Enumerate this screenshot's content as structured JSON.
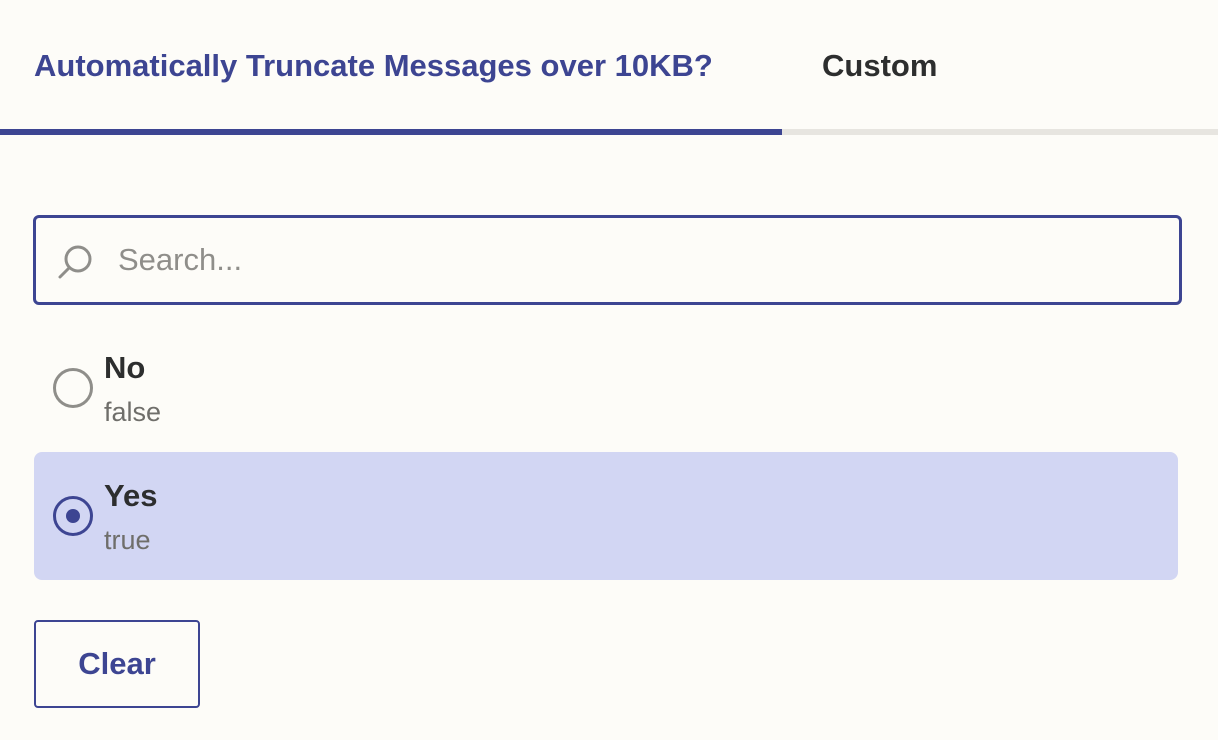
{
  "tabs": [
    {
      "label": "Automatically Truncate Messages over 10KB?",
      "active": true
    },
    {
      "label": "Custom",
      "active": false
    }
  ],
  "search": {
    "placeholder": "Search...",
    "value": "",
    "icon": "search-icon"
  },
  "options": [
    {
      "label": "No",
      "value": "false",
      "selected": false
    },
    {
      "label": "Yes",
      "value": "true",
      "selected": true
    }
  ],
  "clear_button": {
    "label": "Clear"
  },
  "colors": {
    "accent": "#3d4592",
    "selected_background": "#d2d6f3",
    "page_background": "#fdfcf8",
    "text_primary": "#2d2e2e",
    "text_secondary": "#6f6e6a",
    "radio_unselected": "#8f8e8a",
    "tab_track": "#e7e5e0"
  }
}
